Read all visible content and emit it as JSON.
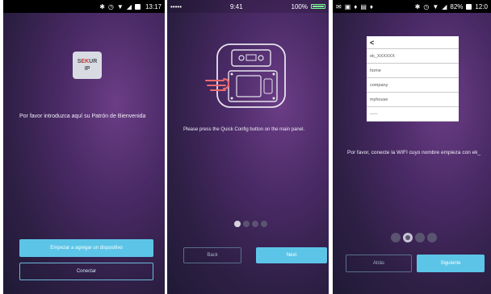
{
  "screens": [
    {
      "status": {
        "time": "13:17"
      },
      "logo": {
        "line1_pre": "S",
        "line1_mid": "EK",
        "line1_post": "UR",
        "line2": "IP"
      },
      "intro_text": "Por favor introduzca aquí su Patrón de Bienvenida",
      "primary_button": "Empezar a agregar un dispositivo",
      "secondary_button": "Conectar"
    },
    {
      "status": {
        "carrier": "•••••",
        "time": "9:41",
        "battery": "100%"
      },
      "instruction": "Please press the Quick Config button on the main panel.",
      "pager": {
        "total": 4,
        "active": 0
      },
      "back_button": "Back",
      "next_button": "Next"
    },
    {
      "status": {
        "battery": "82%",
        "time": "12:0"
      },
      "wifi_list": {
        "back": "<",
        "items": [
          "ek_XXXXXX",
          "home",
          "company",
          "myhouse",
          "•••••"
        ]
      },
      "wifi_text": "Por favor, conecte  la WIFI cuyo nombre empieza con ek_",
      "pager": {
        "total": 4,
        "active": 1
      },
      "back_button": "Atrás",
      "next_button": "Siguiente"
    }
  ],
  "colors": {
    "accent": "#5cc5e7",
    "background": "#3a2454",
    "text": "#f0eef6"
  }
}
